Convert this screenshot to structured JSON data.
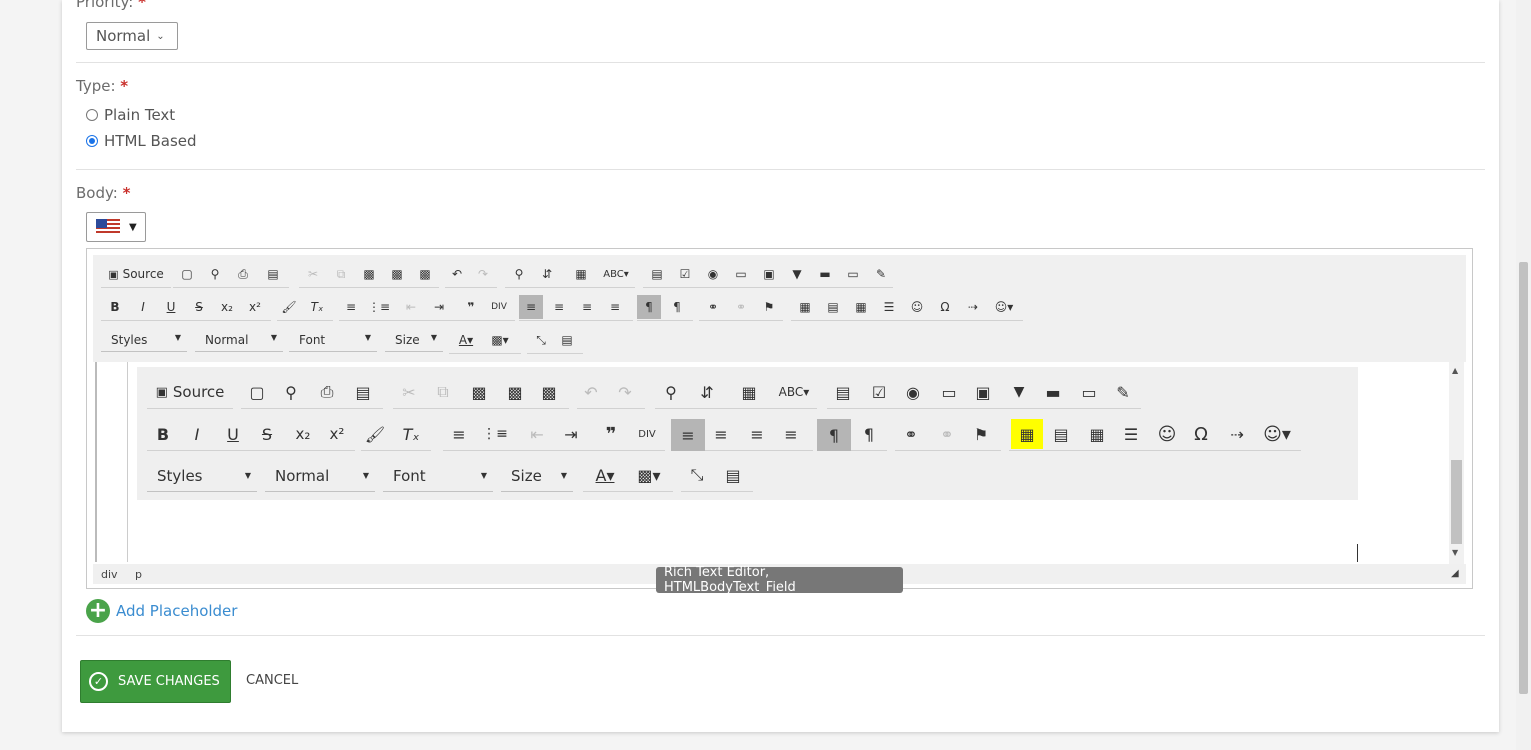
{
  "form": {
    "priority_label": "Priority:",
    "priority_value": "Normal",
    "type_label": "Type:",
    "type_options": [
      "Plain Text",
      "HTML Based"
    ],
    "type_selected": "HTML Based",
    "body_label": "Body:",
    "required_mark": "*",
    "language_flag": "us-flag-icon"
  },
  "editor": {
    "source_label": "Source",
    "combos": [
      "Styles",
      "Normal",
      "Font",
      "Size"
    ],
    "path": [
      "div",
      "p"
    ],
    "tooltip": "Rich Text Editor, HTMLBodyText_Field",
    "highlight_color": "#ffff00"
  },
  "actions": {
    "add_placeholder": "Add Placeholder",
    "save": "SAVE CHANGES",
    "cancel": "CANCEL"
  }
}
